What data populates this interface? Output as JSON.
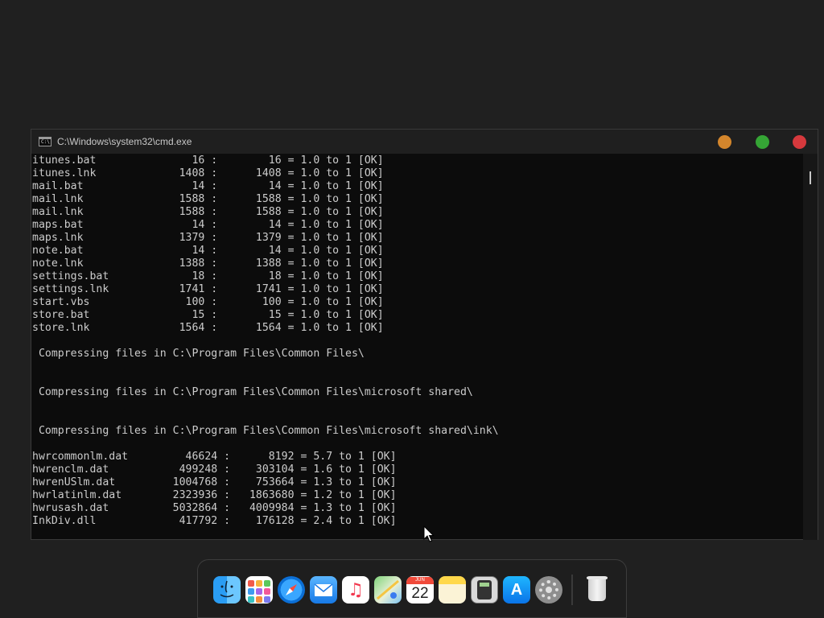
{
  "window": {
    "title": "C:\\Windows\\system32\\cmd.exe",
    "icon_text": "C:\\",
    "controls": {
      "minimize_color": "#d4862c",
      "maximize_color": "#35a535",
      "close_color": "#d6393d"
    }
  },
  "console": {
    "lines": [
      "itunes.bat               16 :        16 = 1.0 to 1 [OK]",
      "itunes.lnk             1408 :      1408 = 1.0 to 1 [OK]",
      "mail.bat                 14 :        14 = 1.0 to 1 [OK]",
      "mail.lnk               1588 :      1588 = 1.0 to 1 [OK]",
      "mail.lnk               1588 :      1588 = 1.0 to 1 [OK]",
      "maps.bat                 14 :        14 = 1.0 to 1 [OK]",
      "maps.lnk               1379 :      1379 = 1.0 to 1 [OK]",
      "note.bat                 14 :        14 = 1.0 to 1 [OK]",
      "note.lnk               1388 :      1388 = 1.0 to 1 [OK]",
      "settings.bat             18 :        18 = 1.0 to 1 [OK]",
      "settings.lnk           1741 :      1741 = 1.0 to 1 [OK]",
      "start.vbs               100 :       100 = 1.0 to 1 [OK]",
      "store.bat                15 :        15 = 1.0 to 1 [OK]",
      "store.lnk              1564 :      1564 = 1.0 to 1 [OK]",
      "",
      " Compressing files in C:\\Program Files\\Common Files\\",
      "",
      "",
      " Compressing files in C:\\Program Files\\Common Files\\microsoft shared\\",
      "",
      "",
      " Compressing files in C:\\Program Files\\Common Files\\microsoft shared\\ink\\",
      "",
      "hwrcommonlm.dat         46624 :      8192 = 5.7 to 1 [OK]",
      "hwrenclm.dat           499248 :    303104 = 1.6 to 1 [OK]",
      "hwrenUSlm.dat         1004768 :    753664 = 1.3 to 1 [OK]",
      "hwrlatinlm.dat        2323936 :   1863680 = 1.2 to 1 [OK]",
      "hwrusash.dat          5032864 :   4009984 = 1.3 to 1 [OK]",
      "InkDiv.dll             417792 :    176128 = 2.4 to 1 [OK]"
    ]
  },
  "dock": {
    "items": [
      {
        "name": "finder",
        "icon": "finder-icon"
      },
      {
        "name": "launchpad",
        "icon": "launchpad-icon"
      },
      {
        "name": "safari",
        "icon": "safari-icon"
      },
      {
        "name": "mail",
        "icon": "mail-icon"
      },
      {
        "name": "music",
        "icon": "music-icon"
      },
      {
        "name": "maps",
        "icon": "maps-icon"
      },
      {
        "name": "calendar",
        "icon": "calendar-icon",
        "month": "JUN",
        "day": "22"
      },
      {
        "name": "notes",
        "icon": "notes-icon"
      },
      {
        "name": "calculator",
        "icon": "calculator-icon"
      },
      {
        "name": "app-store",
        "icon": "app-store-icon"
      },
      {
        "name": "system-settings",
        "icon": "settings-icon"
      },
      {
        "name": "trash",
        "icon": "trash-icon"
      }
    ]
  }
}
